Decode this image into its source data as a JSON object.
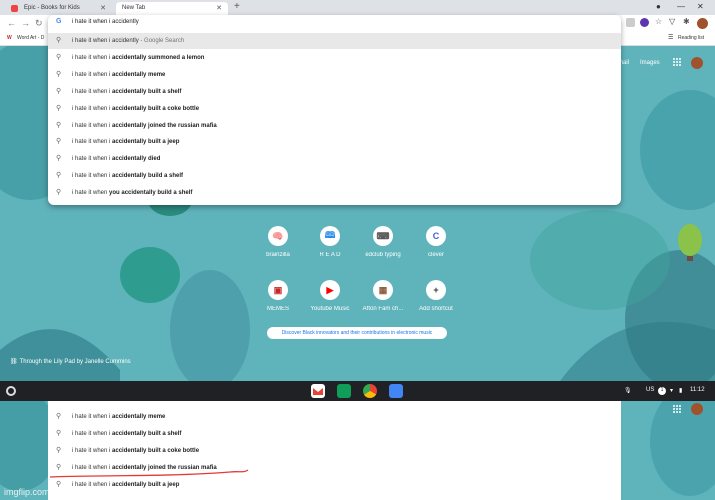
{
  "browser": {
    "tabs": [
      {
        "title": "Epic - Books for Kids"
      },
      {
        "title": "New Tab"
      }
    ],
    "new_tab_symbol": "+",
    "omnibox": {
      "query": "i hate it when i accidently"
    },
    "bookmarks": {
      "first": "Word Art - D",
      "reading_list": "Reading list"
    }
  },
  "suggestions": [
    {
      "prefix": "i hate it when i accidently",
      "bold": "",
      "hint": " - Google Search"
    },
    {
      "prefix": "i hate it when i ",
      "bold": "accidentally summoned a lemon",
      "hint": ""
    },
    {
      "prefix": "i hate it when i ",
      "bold": "accidentally meme",
      "hint": ""
    },
    {
      "prefix": "i hate it when i ",
      "bold": "accidentally built a shelf",
      "hint": ""
    },
    {
      "prefix": "i hate it when i ",
      "bold": "accidentally built a coke bottle",
      "hint": ""
    },
    {
      "prefix": "i hate it when i ",
      "bold": "accidentally joined the russian mafia",
      "hint": ""
    },
    {
      "prefix": "i hate it when i ",
      "bold": "accidentally built a jeep",
      "hint": ""
    },
    {
      "prefix": "i hate it when i ",
      "bold": "accidentally died",
      "hint": ""
    },
    {
      "prefix": "i hate it when i ",
      "bold": "accidentally build a shelf",
      "hint": ""
    },
    {
      "prefix": "i hate it when ",
      "bold": "you accidentally build a shelf",
      "hint": ""
    }
  ],
  "header_links": {
    "gmail": "mail",
    "images": "Images"
  },
  "shortcuts": [
    {
      "label": "brainzilla",
      "icon": "brain-icon",
      "glyph": "🧠",
      "color": "#e57373"
    },
    {
      "label": "R E A D",
      "icon": "read-icon",
      "glyph": "🕮",
      "color": "#1e88e5"
    },
    {
      "label": "edclub typing",
      "icon": "edclub-icon",
      "glyph": "⌨",
      "color": "#555555"
    },
    {
      "label": "clever",
      "icon": "clever-icon",
      "glyph": "C",
      "color": "#4a5bd4"
    },
    {
      "label": "MEMES",
      "icon": "memes-icon",
      "glyph": "▣",
      "color": "#c62828"
    },
    {
      "label": "Youtube Music",
      "icon": "youtube-music-icon",
      "glyph": "▶",
      "color": "#ff0000"
    },
    {
      "label": "Afton Fam ch...",
      "icon": "afton-icon",
      "glyph": "▦",
      "color": "#8e5a3c"
    },
    {
      "label": "Add shortcut",
      "icon": "plus-icon",
      "glyph": "+",
      "color": "#333333"
    }
  ],
  "banner": "Discover Black innovators and their contributions in electronic music",
  "credit": "Through the Lily Pad by Janelle Cummins",
  "shelf": {
    "status": "US",
    "notif": "1",
    "time": "11:12"
  },
  "bottom": {
    "rows": [
      {
        "prefix": "i hate it when i ",
        "bold": "accidentally meme"
      },
      {
        "prefix": "i hate it when i ",
        "bold": "accidentally built a shelf"
      },
      {
        "prefix": "i hate it when i ",
        "bold": "accidentally built a coke bottle"
      },
      {
        "prefix": "i hate it when i ",
        "bold": "accidentally joined the russian mafia"
      },
      {
        "prefix": "i hate it when i ",
        "bold": "accidentally built a jeep"
      }
    ],
    "watermark": "imgflip.com"
  },
  "colors": {
    "wallpaper": "#5fb3bb",
    "underline": "#e53935",
    "shelf": "#202124"
  }
}
